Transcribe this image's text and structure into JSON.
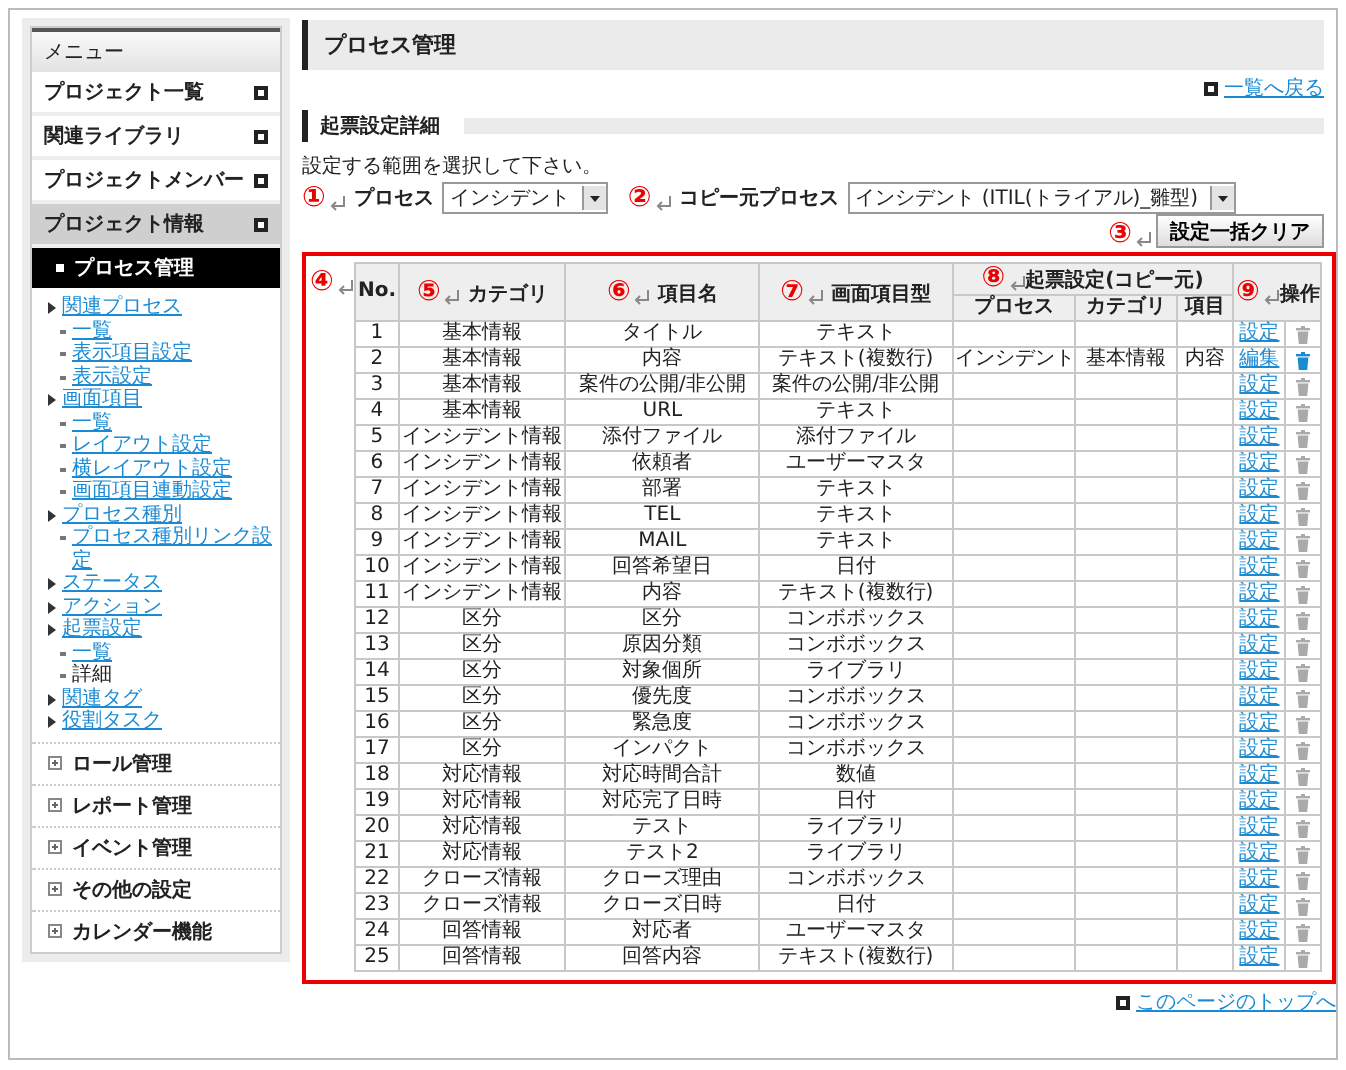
{
  "sidebar": {
    "title": "メニュー",
    "items": [
      {
        "label": "プロジェクト一覧",
        "expanded": false
      },
      {
        "label": "関連ライブラリ",
        "expanded": false
      },
      {
        "label": "プロジェクトメンバー",
        "expanded": false
      },
      {
        "label": "プロジェクト情報",
        "expanded": true
      }
    ],
    "active_section": "プロセス管理",
    "tree": [
      {
        "label": "関連プロセス",
        "current": false,
        "children": [
          {
            "label": "一覧",
            "current": false
          },
          {
            "label": "表示項目設定",
            "current": false
          },
          {
            "label": "表示設定",
            "current": false
          }
        ]
      },
      {
        "label": "画面項目",
        "current": false,
        "children": [
          {
            "label": "一覧",
            "current": false
          },
          {
            "label": "レイアウト設定",
            "current": false
          },
          {
            "label": "横レイアウト設定",
            "current": false
          },
          {
            "label": "画面項目連動設定",
            "current": false
          }
        ]
      },
      {
        "label": "プロセス種別",
        "current": false,
        "children": [
          {
            "label": "プロセス種別リンク設定",
            "current": false
          }
        ]
      },
      {
        "label": "ステータス",
        "current": false
      },
      {
        "label": "アクション",
        "current": false
      },
      {
        "label": "起票設定",
        "current": false,
        "children": [
          {
            "label": "一覧",
            "current": false
          },
          {
            "label": "詳細",
            "current": true
          }
        ]
      },
      {
        "label": "関連タグ",
        "current": false
      },
      {
        "label": "役割タスク",
        "current": false
      }
    ],
    "sections": [
      "ロール管理",
      "レポート管理",
      "イベント管理",
      "その他の設定",
      "カレンダー機能"
    ]
  },
  "main": {
    "page_title": "プロセス管理",
    "back_link": "一覧へ戻る",
    "section_title": "起票設定詳細",
    "instruction": "設定する範囲を選択して下さい。",
    "filters": [
      {
        "marker": "①",
        "label": "プロセス",
        "value": "インシデント"
      },
      {
        "marker": "②",
        "label": "コピー元プロセス",
        "value": "インシデント (ITIL(トライアル)_雛型)"
      }
    ],
    "clear_button": {
      "marker": "③",
      "label": "設定一括クリア"
    },
    "top_link": "このページのトップへ"
  },
  "table": {
    "columns": [
      {
        "marker": "④",
        "label": "No."
      },
      {
        "marker": "⑤",
        "label": "カテゴリ"
      },
      {
        "marker": "⑥",
        "label": "項目名"
      },
      {
        "marker": "⑦",
        "label": "画面項目型"
      }
    ],
    "group": {
      "marker": "⑧",
      "label": "起票設定(コピー元)",
      "columns": [
        "プロセス",
        "カテゴリ",
        "項目"
      ]
    },
    "actions": {
      "marker": "⑨",
      "label": "操作"
    },
    "rows": [
      {
        "no": "1",
        "category": "基本情報",
        "item": "タイトル",
        "type": "テキスト",
        "action": "設定",
        "deletable": false
      },
      {
        "no": "2",
        "category": "基本情報",
        "item": "内容",
        "type": "テキスト(複数行)",
        "copy_process": "インシデント",
        "copy_category": "基本情報",
        "copy_item": "内容",
        "action": "編集",
        "deletable": true
      },
      {
        "no": "3",
        "category": "基本情報",
        "item": "案件の公開/非公開",
        "type": "案件の公開/非公開",
        "action": "設定",
        "deletable": false
      },
      {
        "no": "4",
        "category": "基本情報",
        "item": "URL",
        "type": "テキスト",
        "action": "設定",
        "deletable": false
      },
      {
        "no": "5",
        "category": "インシデント情報",
        "item": "添付ファイル",
        "type": "添付ファイル",
        "action": "設定",
        "deletable": false
      },
      {
        "no": "6",
        "category": "インシデント情報",
        "item": "依頼者",
        "type": "ユーザーマスタ",
        "action": "設定",
        "deletable": false
      },
      {
        "no": "7",
        "category": "インシデント情報",
        "item": "部署",
        "type": "テキスト",
        "action": "設定",
        "deletable": false
      },
      {
        "no": "8",
        "category": "インシデント情報",
        "item": "TEL",
        "type": "テキスト",
        "action": "設定",
        "deletable": false
      },
      {
        "no": "9",
        "category": "インシデント情報",
        "item": "MAIL",
        "type": "テキスト",
        "action": "設定",
        "deletable": false
      },
      {
        "no": "10",
        "category": "インシデント情報",
        "item": "回答希望日",
        "type": "日付",
        "action": "設定",
        "deletable": false
      },
      {
        "no": "11",
        "category": "インシデント情報",
        "item": "内容",
        "type": "テキスト(複数行)",
        "action": "設定",
        "deletable": false
      },
      {
        "no": "12",
        "category": "区分",
        "item": "区分",
        "type": "コンボボックス",
        "action": "設定",
        "deletable": false
      },
      {
        "no": "13",
        "category": "区分",
        "item": "原因分類",
        "type": "コンボボックス",
        "action": "設定",
        "deletable": false
      },
      {
        "no": "14",
        "category": "区分",
        "item": "対象個所",
        "type": "ライブラリ",
        "action": "設定",
        "deletable": false
      },
      {
        "no": "15",
        "category": "区分",
        "item": "優先度",
        "type": "コンボボックス",
        "action": "設定",
        "deletable": false
      },
      {
        "no": "16",
        "category": "区分",
        "item": "緊急度",
        "type": "コンボボックス",
        "action": "設定",
        "deletable": false
      },
      {
        "no": "17",
        "category": "区分",
        "item": "インパクト",
        "type": "コンボボックス",
        "action": "設定",
        "deletable": false
      },
      {
        "no": "18",
        "category": "対応情報",
        "item": "対応時間合計",
        "type": "数値",
        "action": "設定",
        "deletable": false
      },
      {
        "no": "19",
        "category": "対応情報",
        "item": "対応完了日時",
        "type": "日付",
        "action": "設定",
        "deletable": false
      },
      {
        "no": "20",
        "category": "対応情報",
        "item": "テスト",
        "type": "ライブラリ",
        "action": "設定",
        "deletable": false
      },
      {
        "no": "21",
        "category": "対応情報",
        "item": "テスト2",
        "type": "ライブラリ",
        "action": "設定",
        "deletable": false
      },
      {
        "no": "22",
        "category": "クローズ情報",
        "item": "クローズ理由",
        "type": "コンボボックス",
        "action": "設定",
        "deletable": false
      },
      {
        "no": "23",
        "category": "クローズ情報",
        "item": "クローズ日時",
        "type": "日付",
        "action": "設定",
        "deletable": false
      },
      {
        "no": "24",
        "category": "回答情報",
        "item": "対応者",
        "type": "ユーザーマスタ",
        "action": "設定",
        "deletable": false
      },
      {
        "no": "25",
        "category": "回答情報",
        "item": "回答内容",
        "type": "テキスト(複数行)",
        "action": "設定",
        "deletable": false
      }
    ]
  }
}
